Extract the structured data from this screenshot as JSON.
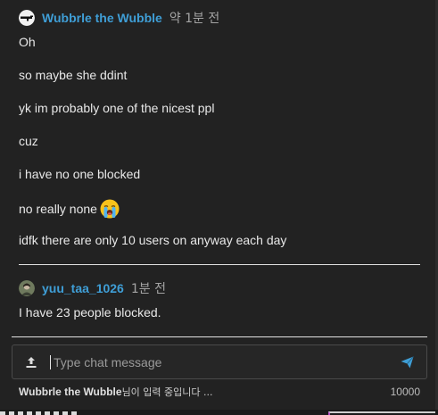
{
  "messages": [
    {
      "username": "Wubbrle the Wubble",
      "timestamp": "약 1분 전",
      "lines": [
        "Oh",
        "so maybe she ddint",
        "yk im probably one of the nicest ppl",
        "cuz",
        "i have no one blocked",
        "no really none",
        "idfk there are only 10 users on anyway each day"
      ],
      "emoji": "loudly-crying-face"
    },
    {
      "username": "yuu_taa_1026",
      "timestamp": "1분 전",
      "lines": [
        "I have 23 people blocked."
      ]
    }
  ],
  "chat_input": {
    "placeholder": "Type chat message",
    "value": ""
  },
  "typing_indicator": {
    "name": "Wubbrle the Wubble",
    "suffix": "님이 입력 중입니다 ..."
  },
  "char_limit": "10000",
  "colors": {
    "background": "#222222",
    "username": "#3f9ed6",
    "send_icon": "#3f9ed6"
  },
  "icons": {
    "upload": "upload-icon",
    "send": "send-icon"
  }
}
